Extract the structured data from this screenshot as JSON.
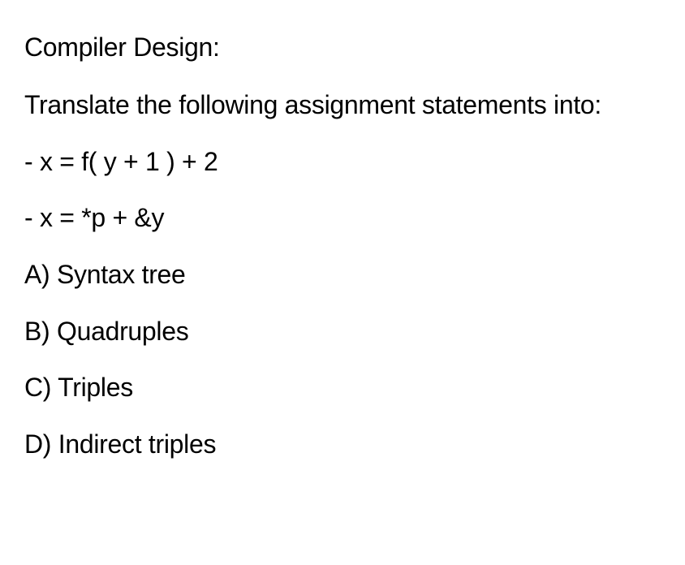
{
  "title": "Compiler Design:",
  "instruction": "Translate the following assignment statements into:",
  "statements": [
    "- x = f( y + 1 ) + 2",
    "- x = *p + &y"
  ],
  "options": [
    "A) Syntax tree",
    "B) Quadruples",
    "C) Triples",
    "D) Indirect triples"
  ]
}
